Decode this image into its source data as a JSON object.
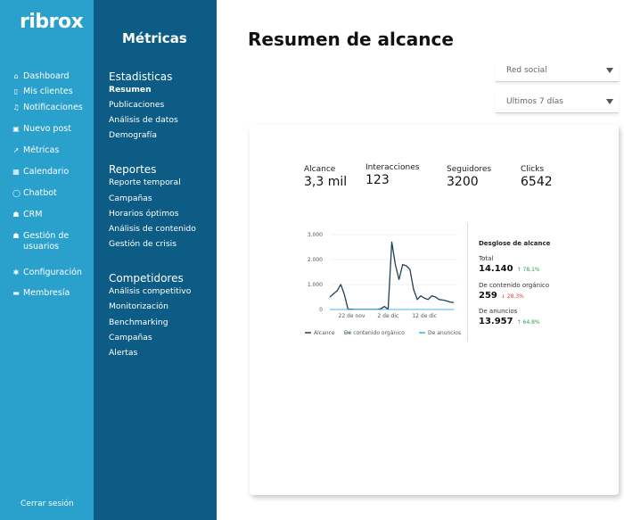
{
  "app": {
    "logo": "ribrox"
  },
  "nav": {
    "items": [
      {
        "label": "Dashboard",
        "icon": "home-icon",
        "glyph": "⌂"
      },
      {
        "label": "Mis clientes",
        "icon": "phone-icon",
        "glyph": "▯"
      },
      {
        "label": "Notificaciones",
        "icon": "bell-icon",
        "glyph": "♫"
      },
      {
        "label": "Nuevo post",
        "icon": "image-icon",
        "glyph": "▣"
      },
      {
        "label": "Métricas",
        "icon": "chart-icon",
        "glyph": "↗"
      },
      {
        "label": "Calendario",
        "icon": "calendar-icon",
        "glyph": "▦"
      },
      {
        "label": "Chatbot",
        "icon": "chat-icon",
        "glyph": "◯"
      },
      {
        "label": "CRM",
        "icon": "users-icon",
        "glyph": "☗"
      },
      {
        "label": "Gestión de usuarios",
        "line1": "Gestión de",
        "line2": "usuarios",
        "icon": "user-group-icon",
        "glyph": "☗"
      },
      {
        "label": "Configuración",
        "icon": "gear-icon",
        "glyph": "✱"
      },
      {
        "label": "Membresía",
        "icon": "card-icon",
        "glyph": "▬"
      }
    ],
    "logout": "Cerrar sesión"
  },
  "panel": {
    "title": "Métricas",
    "sections": [
      {
        "heading": "Estadisticas",
        "items": [
          "Resumen",
          "Publicaciones",
          "Análisis de datos",
          "Demografía"
        ]
      },
      {
        "heading": "Reportes",
        "items": [
          "Reporte temporal",
          "Campañas",
          "Horarios óptimos",
          "Análisis de contenido",
          "Gestión de crisis"
        ]
      },
      {
        "heading": "Competidores",
        "items": [
          "Análisis competitivo",
          "Monitorización",
          "Benchmarking",
          "Campañas",
          "Alertas"
        ]
      }
    ],
    "active": "Resumen"
  },
  "main": {
    "title": "Resumen de alcance",
    "filters": {
      "network_placeholder": "Red social",
      "period": "Ultimos 7 días"
    },
    "kpis": [
      {
        "label": "Alcance",
        "value": "3,3 mil"
      },
      {
        "label": "Interacciones",
        "value": "123"
      },
      {
        "label": "Seguidores",
        "value": "3200"
      },
      {
        "label": "Clicks",
        "value": "6542"
      }
    ],
    "breakdown": {
      "title": "Desglose de alcance",
      "rows": [
        {
          "label": "Total",
          "value": "14.140",
          "delta": "↑ 78,1%",
          "direction": "up"
        },
        {
          "label": "De contenido orgánico",
          "value": "259",
          "delta": "↓ 28,3%",
          "direction": "down"
        },
        {
          "label": "De anuncios",
          "value": "13.957",
          "delta": "↑ 64,8%",
          "direction": "up"
        }
      ]
    }
  },
  "colors": {
    "nav_bg": "#2aa0cc",
    "panel_bg": "#0d5c86",
    "series_alcance": "#1f3f55",
    "series_organico": "#7fd3ee",
    "series_anuncios": "#3fb0e0",
    "up": "#2e9d5a",
    "down": "#d9443a"
  },
  "chart_data": {
    "type": "line",
    "x_tick_labels": [
      "22 de nov",
      "2 de dic",
      "12 de dic"
    ],
    "y_ticks": [
      0,
      1000,
      2000,
      3000
    ],
    "y_tick_labels": [
      "0",
      "1.000",
      "2.000",
      "3.000"
    ],
    "ylim": [
      0,
      3000
    ],
    "x_range_days": [
      0,
      35
    ],
    "x_tick_positions_days": [
      6,
      16,
      26
    ],
    "grid": true,
    "legend_position": "bottom",
    "series": [
      {
        "name": "Alcance",
        "color": "#1f3f55",
        "x": [
          0,
          2,
          3,
          4,
          5,
          6,
          7,
          8,
          9,
          10,
          11,
          12,
          13,
          14,
          15,
          16,
          17,
          18,
          19,
          20,
          21,
          22,
          23,
          24,
          25,
          26,
          27,
          28,
          29,
          30,
          31,
          32,
          33,
          34
        ],
        "values": [
          500,
          750,
          1000,
          600,
          10,
          10,
          5,
          5,
          5,
          5,
          5,
          5,
          5,
          30,
          120,
          10,
          2700,
          1800,
          1200,
          1800,
          1750,
          1600,
          800,
          400,
          550,
          450,
          400,
          550,
          500,
          400,
          380,
          350,
          300,
          280
        ]
      },
      {
        "name": "De contenido orgánico",
        "color": "#7fd3ee",
        "x": [
          0,
          34
        ],
        "values": [
          5,
          5
        ]
      },
      {
        "name": "De anuncios",
        "color": "#3fb0e0",
        "x": [
          0,
          34
        ],
        "values": [
          3,
          3
        ]
      }
    ]
  }
}
